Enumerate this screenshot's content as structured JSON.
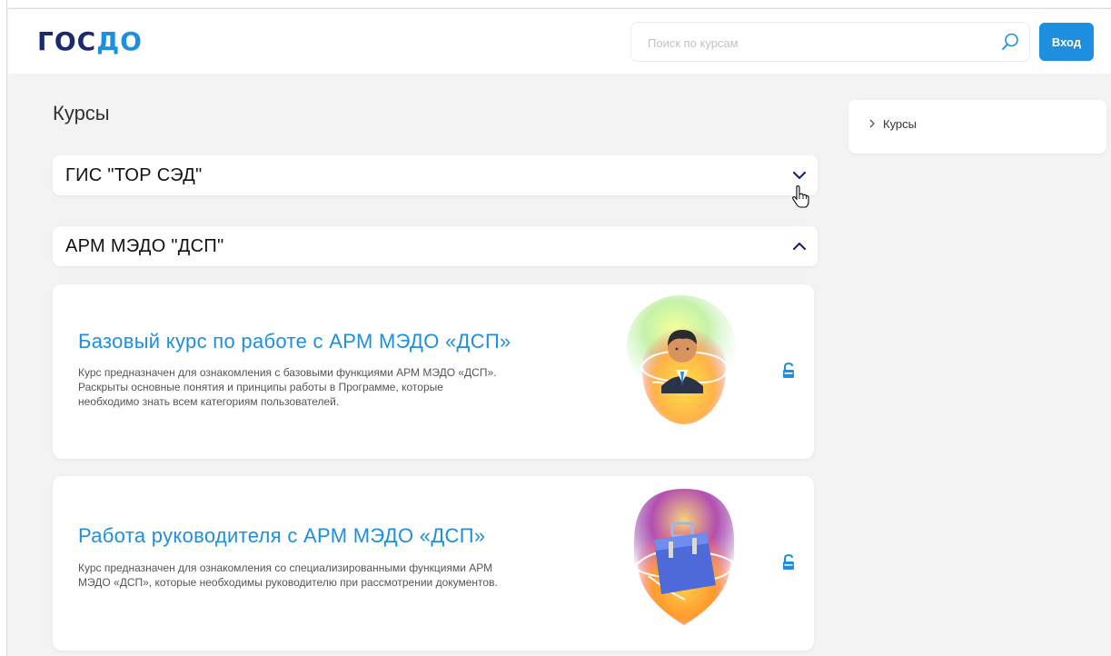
{
  "header": {
    "logo_left": "ГОС",
    "logo_right": "ДО",
    "search_placeholder": "Поиск по курсам",
    "login_label": "Вход"
  },
  "page": {
    "title": "Курсы"
  },
  "sections": [
    {
      "title": "ГИС \"ТОР СЭД\"",
      "state": "collapsed",
      "chevron": "chevron-down-icon"
    },
    {
      "title": "АРМ МЭДО \"ДСП\"",
      "state": "expanded",
      "chevron": "chevron-up-icon"
    }
  ],
  "courses": [
    {
      "title": "Базовый курс по работе с АРМ МЭДО «ДСП»",
      "description_lines": [
        "Курс предназначен для ознакомления с базовыми функциями АРМ МЭДО «ДСП».",
        "Раскрыты основные понятия и принципы работы в Программе, которые",
        "необходимо знать всем категориям пользователей."
      ],
      "illustration": "user-avatar-illustration",
      "status_icon": "unlock-icon"
    },
    {
      "title": "Работа руководителя с АРМ МЭДО «ДСП»",
      "description_lines": [
        "Курс предназначен для ознакомления со специализированными функциями АРМ",
        "МЭДО «ДСП», которые необходимы руководителю при рассмотрении документов."
      ],
      "illustration": "briefcase-illustration",
      "status_icon": "unlock-icon"
    }
  ],
  "sidebar": {
    "breadcrumb_label": "Курсы"
  },
  "colors": {
    "accent": "#1d8fde",
    "logo_dark": "#1b2a6b",
    "background": "#f3f3f3"
  }
}
